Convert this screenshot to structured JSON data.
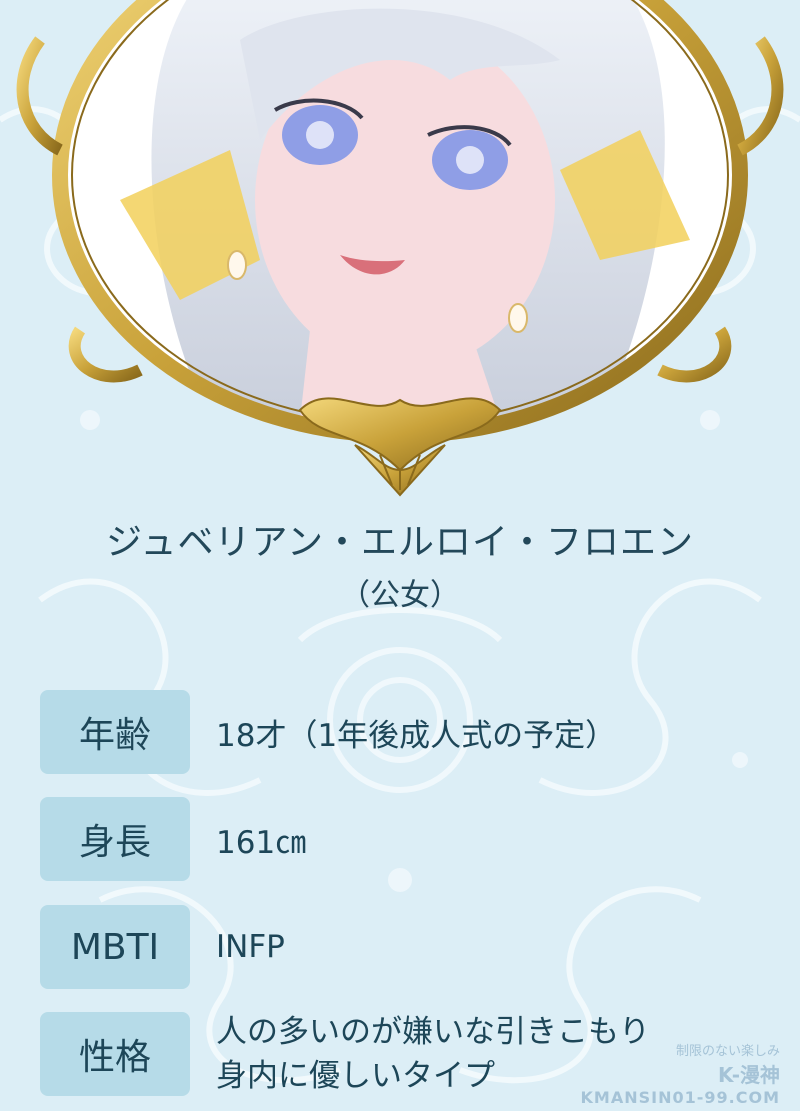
{
  "profile": {
    "name": "ジュベリアン・エルロイ・フロエン",
    "title": "（公女）"
  },
  "rows": [
    {
      "label": "年齢",
      "value": "18才（1年後成人式の予定）"
    },
    {
      "label": "身長",
      "value": "161㎝"
    },
    {
      "label": "MBTI",
      "value": "INFP"
    },
    {
      "label": "性格",
      "value_line1": "人の多いのが嫌いな引きこもり",
      "value_line2": "身内に優しいタイプ"
    }
  ],
  "watermark": {
    "tagline": "制限のない楽しみ",
    "brand": "K-漫神",
    "url": "KMANSIN01-99.COM"
  },
  "colors": {
    "background": "#dceef6",
    "label_box": "#b6dbe8",
    "text": "#1d4658",
    "frame_gold": "#c9a23a"
  }
}
